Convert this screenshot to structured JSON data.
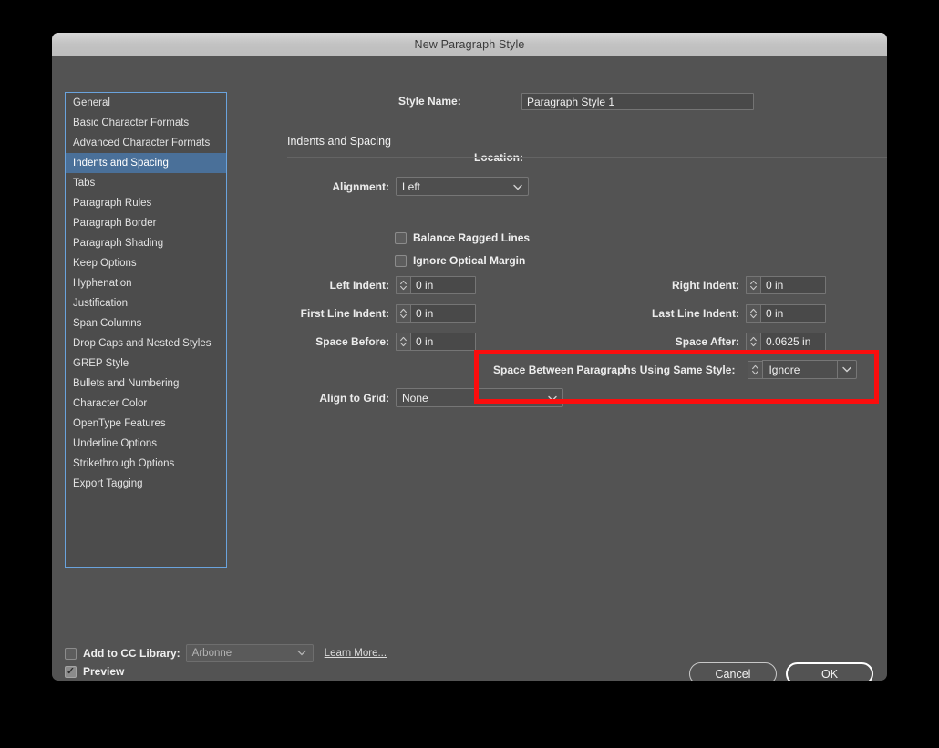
{
  "window": {
    "title": "New Paragraph Style"
  },
  "sidebar": {
    "items": [
      {
        "label": "General",
        "selected": false
      },
      {
        "label": "Basic Character Formats",
        "selected": false
      },
      {
        "label": "Advanced Character Formats",
        "selected": false
      },
      {
        "label": "Indents and Spacing",
        "selected": true
      },
      {
        "label": "Tabs",
        "selected": false
      },
      {
        "label": "Paragraph Rules",
        "selected": false
      },
      {
        "label": "Paragraph Border",
        "selected": false
      },
      {
        "label": "Paragraph Shading",
        "selected": false
      },
      {
        "label": "Keep Options",
        "selected": false
      },
      {
        "label": "Hyphenation",
        "selected": false
      },
      {
        "label": "Justification",
        "selected": false
      },
      {
        "label": "Span Columns",
        "selected": false
      },
      {
        "label": "Drop Caps and Nested Styles",
        "selected": false
      },
      {
        "label": "GREP Style",
        "selected": false
      },
      {
        "label": "Bullets and Numbering",
        "selected": false
      },
      {
        "label": "Character Color",
        "selected": false
      },
      {
        "label": "OpenType Features",
        "selected": false
      },
      {
        "label": "Underline Options",
        "selected": false
      },
      {
        "label": "Strikethrough Options",
        "selected": false
      },
      {
        "label": "Export Tagging",
        "selected": false
      }
    ]
  },
  "header": {
    "style_name_label": "Style Name:",
    "style_name_value": "Paragraph Style 1",
    "location_label": "Location:",
    "location_value": ""
  },
  "section": {
    "title": "Indents and Spacing"
  },
  "fields": {
    "alignment": {
      "label": "Alignment:",
      "value": "Left"
    },
    "balance_ragged_lines": {
      "label": "Balance Ragged Lines",
      "checked": false
    },
    "ignore_optical_margin": {
      "label": "Ignore Optical Margin",
      "checked": false
    },
    "left_indent": {
      "label": "Left Indent:",
      "value": "0 in"
    },
    "first_line_indent": {
      "label": "First Line Indent:",
      "value": "0 in"
    },
    "space_before": {
      "label": "Space Before:",
      "value": "0 in"
    },
    "right_indent": {
      "label": "Right Indent:",
      "value": "0 in"
    },
    "last_line_indent": {
      "label": "Last Line Indent:",
      "value": "0 in"
    },
    "space_after": {
      "label": "Space After:",
      "value": "0.0625 in"
    },
    "space_between_same_style": {
      "label": "Space Between Paragraphs Using Same Style:",
      "value": "Ignore"
    },
    "align_to_grid": {
      "label": "Align to Grid:",
      "value": "None"
    }
  },
  "footer": {
    "add_to_cc_library": {
      "label": "Add to CC Library:",
      "checked": false
    },
    "cc_library_value": "Arbonne",
    "learn_more": "Learn More...",
    "preview": {
      "label": "Preview",
      "checked": true
    },
    "cancel_label": "Cancel",
    "ok_label": "OK"
  },
  "colors": {
    "dialog_background": "#535353",
    "sidebar_background": "#4c4c4c",
    "sidebar_border": "#6aa3dd",
    "selection_blue": "#4a7099",
    "highlight_red": "#fb0d0d",
    "titlebar": "#c4c4c4"
  }
}
